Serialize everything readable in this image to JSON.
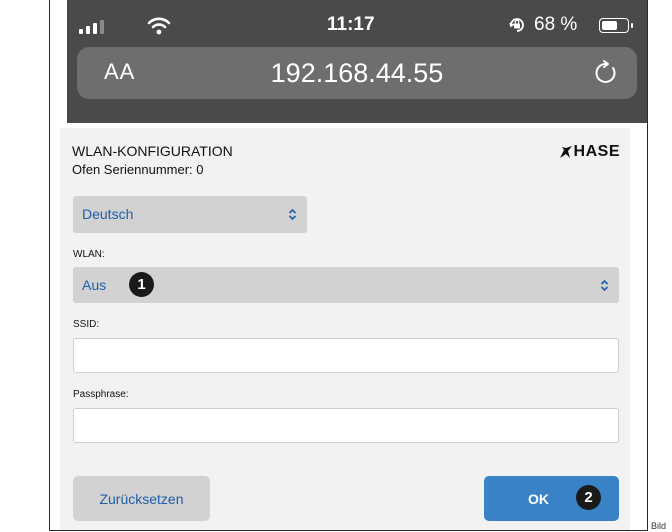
{
  "status_bar": {
    "time": "11:17",
    "battery_percent": "68 %",
    "battery_level": 0.68,
    "icons": [
      "signal-icon",
      "wifi-icon",
      "orientation-lock-icon",
      "battery-icon"
    ]
  },
  "browser": {
    "text_size_label": "AA",
    "url": "192.168.44.55",
    "icons": [
      "reload-icon"
    ]
  },
  "page": {
    "title": "WLAN-KONFIGURATION",
    "serial": "Ofen Seriennummer: 0",
    "logo": "HASE",
    "language": {
      "selected": "Deutsch"
    },
    "wlan": {
      "label": "WLAN:",
      "selected": "Aus"
    },
    "ssid": {
      "label": "SSID:",
      "value": ""
    },
    "passphrase": {
      "label": "Passphrase:",
      "value": ""
    },
    "buttons": {
      "reset": "Zurücksetzen",
      "ok": "OK"
    }
  },
  "markers": [
    "1",
    "2"
  ],
  "caption": "Bild",
  "colors": {
    "status_bar": "#4a4a4a",
    "select_text": "#1f5ea8",
    "primary_button": "#3a82c6",
    "form_background": "#f2f2f2"
  }
}
